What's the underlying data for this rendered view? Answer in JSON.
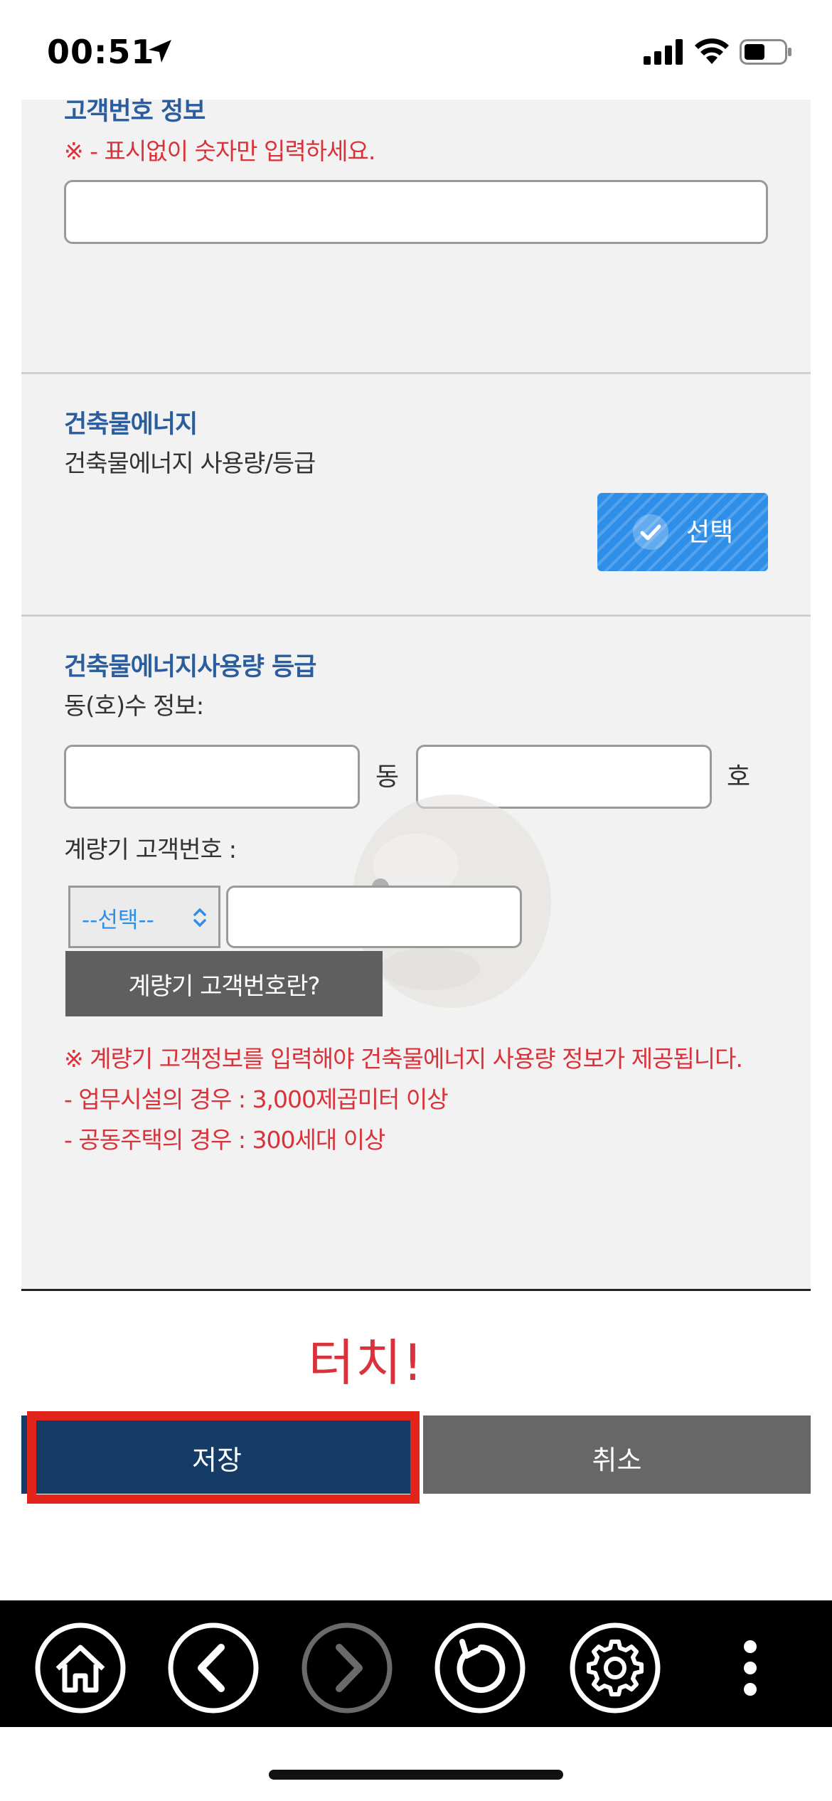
{
  "status_bar": {
    "time": "00:51"
  },
  "customer_section": {
    "title": "고객번호 정보",
    "note": "※ - 표시없이 숫자만 입력하세요.",
    "input_value": ""
  },
  "energy_section": {
    "title": "건축물에너지",
    "description": "건축물에너지 사용량/등급",
    "select_button": "선택"
  },
  "usage_section": {
    "title": "건축물에너지사용량 등급",
    "unit_info_label": "동(호)수 정보:",
    "dong_input_value": "",
    "dong_unit": "동",
    "ho_input_value": "",
    "ho_unit": "호",
    "meter_label": "계량기 고객번호 :",
    "meter_select": "--선택--",
    "meter_input_value": "",
    "help_button": "계량기 고객번호란?",
    "notes": [
      "※ 계량기 고객정보를 입력해야 건축물에너지 사용량 정보가 제공됩니다.",
      "- 업무시설의 경우 : 3,000제곱미터 이상",
      "- 공동주택의 경우 : 300세대 이상"
    ]
  },
  "touch_annotation": "터치!",
  "actions": {
    "save": "저장",
    "cancel": "취소"
  },
  "toolbar": {
    "icons": [
      "home-icon",
      "back-icon",
      "forward-icon",
      "reload-icon",
      "settings-icon",
      "more-icon"
    ]
  },
  "colors": {
    "accent_blue": "#2f8fe8",
    "title_blue": "#2a5d9e",
    "warning_red": "#d9323a",
    "save_navy": "#143c66",
    "highlight_red": "#e3241b"
  }
}
